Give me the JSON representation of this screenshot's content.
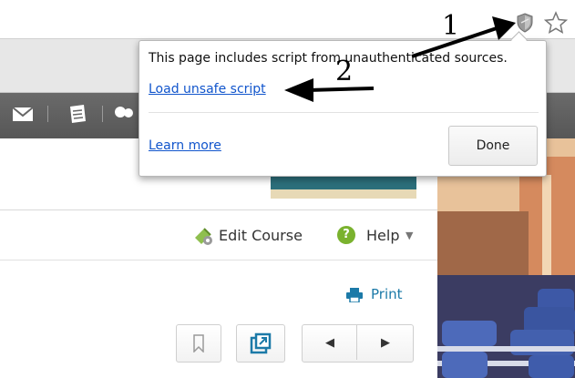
{
  "popup": {
    "message": "This page includes script from unauthenticated sources.",
    "load_unsafe_label": "Load unsafe script",
    "learn_more_label": "Learn more",
    "done_label": "Done"
  },
  "course_bar": {
    "edit_course_label": "Edit Course",
    "help_label": "Help",
    "help_glyph": "?",
    "help_caret": "▼"
  },
  "content": {
    "print_label": "Print"
  },
  "navigation": {
    "prev_glyph": "◀",
    "next_glyph": "▶"
  },
  "annotations": {
    "step1": "1",
    "step2": "2"
  },
  "icons": [
    "shield-icon",
    "star-icon",
    "mail-icon",
    "clipboard-icon",
    "chat-icon",
    "edit-course-icon",
    "help-icon",
    "print-icon",
    "bookmark-icon",
    "popout-icon"
  ],
  "colors": {
    "link": "#1155cc",
    "print": "#1c7aa8",
    "help": "#7ab22e",
    "toolbar": "#5f5f5f"
  }
}
